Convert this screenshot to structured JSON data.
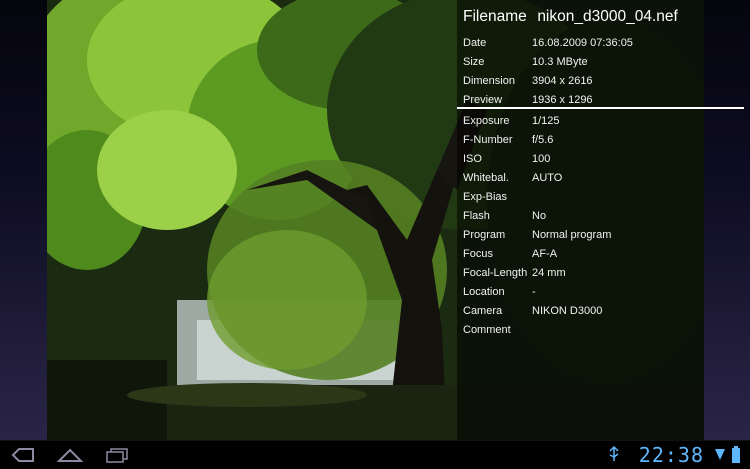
{
  "info": {
    "filename_label": "Filename",
    "filename_value": "nikon_d3000_04.nef",
    "rows_top": [
      {
        "key": "Date",
        "value": "16.08.2009 07:36:05"
      },
      {
        "key": "Size",
        "value": "10.3 MByte"
      },
      {
        "key": "Dimension",
        "value": "3904 x 2616"
      },
      {
        "key": "Preview",
        "value": "1936 x 1296"
      }
    ],
    "rows_exif": [
      {
        "key": "Exposure",
        "value": "1/125"
      },
      {
        "key": "F-Number",
        "value": "f/5.6"
      },
      {
        "key": "ISO",
        "value": "100"
      },
      {
        "key": "Whitebal.",
        "value": "AUTO"
      },
      {
        "key": "Exp-Bias",
        "value": ""
      },
      {
        "key": "Flash",
        "value": "No"
      },
      {
        "key": "Program",
        "value": "Normal program"
      },
      {
        "key": "Focus",
        "value": "AF-A"
      },
      {
        "key": "Focal-Length",
        "value": "24 mm"
      },
      {
        "key": "Location",
        "value": "-"
      },
      {
        "key": "Camera",
        "value": "NIKON D3000"
      },
      {
        "key": "Comment",
        "value": ""
      }
    ]
  },
  "system_bar": {
    "clock": "22:38",
    "icons": [
      "back-icon",
      "home-icon",
      "recent-apps-icon",
      "usb-icon",
      "wifi-icon",
      "battery-icon"
    ],
    "accent": "#5fb8ff"
  }
}
